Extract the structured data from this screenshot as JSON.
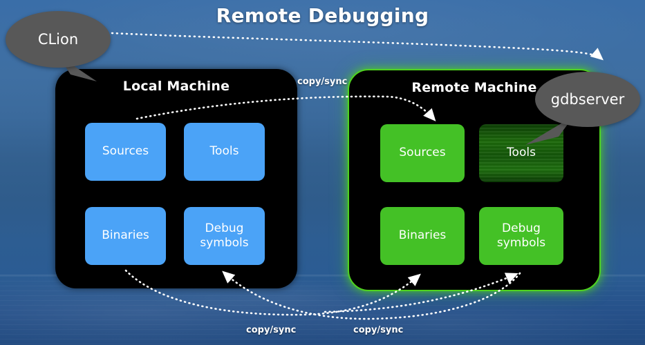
{
  "slide": {
    "title": "Remote Debugging",
    "background_color": "#3a6ea8"
  },
  "colors": {
    "panel": "#000000",
    "local_tile": "#4ba3f7",
    "remote_tile": "#44c126",
    "remote_border_glow": "#4fd41f",
    "bubble": "#585858",
    "text": "#ffffff"
  },
  "bubbles": [
    {
      "id": "clion",
      "label": "CLion"
    },
    {
      "id": "gdbserver",
      "label": "gdbserver"
    }
  ],
  "machines": [
    {
      "id": "local",
      "title": "Local Machine",
      "tile_color": "#4ba3f7",
      "tiles": [
        {
          "id": "sources",
          "label": "Sources"
        },
        {
          "id": "tools",
          "label": "Tools"
        },
        {
          "id": "binaries",
          "label": "Binaries"
        },
        {
          "id": "debug-symbols",
          "label": "Debug\nsymbols"
        }
      ]
    },
    {
      "id": "remote",
      "title": "Remote Machine",
      "tile_color": "#44c126",
      "tiles": [
        {
          "id": "sources",
          "label": "Sources",
          "state": "active"
        },
        {
          "id": "tools",
          "label": "Tools",
          "state": "fading-in"
        },
        {
          "id": "binaries",
          "label": "Binaries",
          "state": "active"
        },
        {
          "id": "debug-symbols",
          "label": "Debug\nsymbols",
          "state": "active"
        }
      ]
    }
  ],
  "arrow_labels": {
    "top": "copy/sync",
    "bottom_left": "copy/sync",
    "bottom_right": "copy/sync"
  },
  "arrows": [
    {
      "id": "clion-to-gdbserver",
      "from": "CLion",
      "to": "gdbserver",
      "style": "dotted",
      "direction": "right"
    },
    {
      "id": "local-sources-to-remote-sources",
      "from": "Sources (Local)",
      "to": "Sources (Remote)",
      "label": "copy/sync",
      "style": "dotted",
      "direction": "right"
    },
    {
      "id": "remote-binaries-from-local",
      "from": "Binaries (Local)",
      "to": "Binaries (Remote)",
      "label": "copy/sync",
      "style": "dotted",
      "direction": "right"
    },
    {
      "id": "remote-debug-to-local-debug",
      "from": "Debug symbols (Remote)",
      "to": "Debug symbols (Local)",
      "label": "copy/sync",
      "style": "dotted",
      "direction": "left"
    }
  ]
}
